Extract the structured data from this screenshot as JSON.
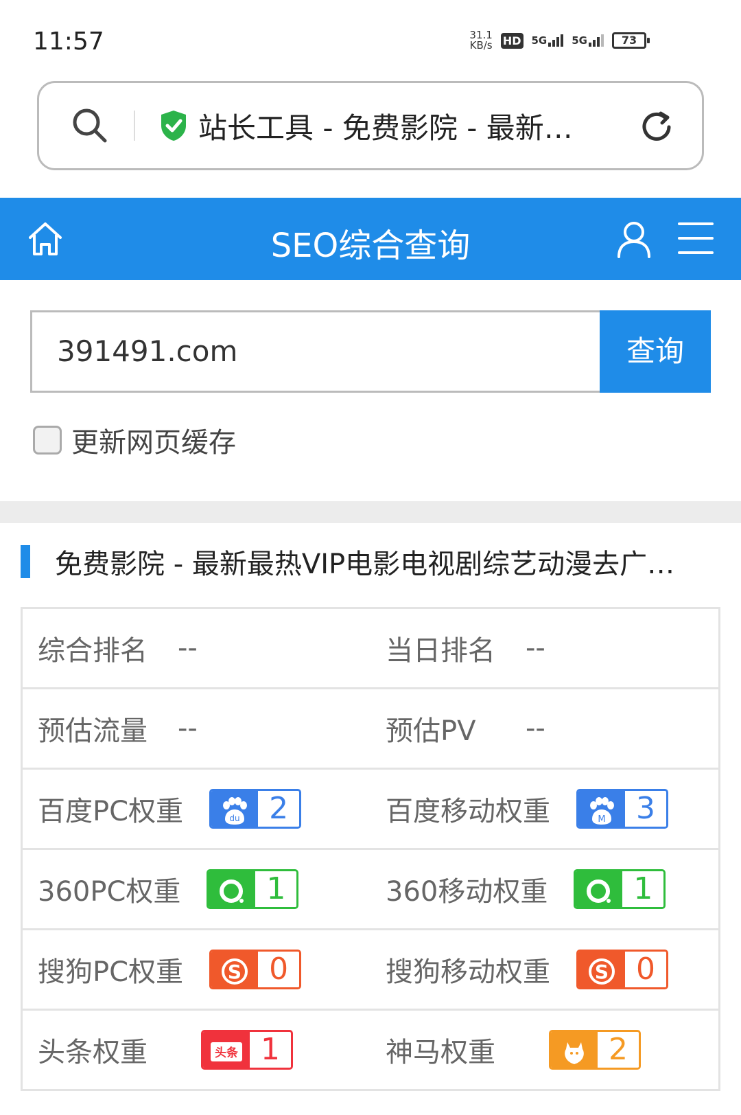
{
  "status": {
    "time": "11:57",
    "speed_value": "31.1",
    "speed_unit": "KB/s",
    "hd": "HD",
    "net1": "5G",
    "net2": "5G",
    "battery": "73"
  },
  "browser": {
    "url_title": "站长工具 - 免费影院 - 最新…"
  },
  "header": {
    "title": "SEO综合查询"
  },
  "search": {
    "value": "391491.com",
    "button": "查询",
    "cache_label": "更新网页缓存"
  },
  "site": {
    "title": "免费影院 - 最新最热VIP电影电视剧综艺动漫去广…"
  },
  "rows": [
    {
      "l_label": "综合排名",
      "l_value": "--",
      "r_label": "当日排名",
      "r_value": "--"
    },
    {
      "l_label": "预估流量",
      "l_value": "--",
      "r_label": "预估PV",
      "r_value": "--"
    },
    {
      "l_label": "百度PC权重",
      "l_value": "2",
      "l_icon": "baidu-icon",
      "r_label": "百度移动权重",
      "r_value": "3",
      "r_icon": "baidu-mobile-icon"
    },
    {
      "l_label": "360PC权重",
      "l_value": "1",
      "l_icon": "360-icon",
      "r_label": "360移动权重",
      "r_value": "1",
      "r_icon": "360-icon"
    },
    {
      "l_label": "搜狗PC权重",
      "l_value": "0",
      "l_icon": "sogou-icon",
      "r_label": "搜狗移动权重",
      "r_value": "0",
      "r_icon": "sogou-icon"
    },
    {
      "l_label": "头条权重",
      "l_value": "1",
      "l_icon": "toutiao-icon",
      "r_label": "神马权重",
      "r_value": "2",
      "r_icon": "shenma-icon"
    }
  ],
  "badge_icon_text": {
    "baidu": "du",
    "baidu_mobile": "M",
    "toutiao": "头条"
  },
  "colors": {
    "primary": "#1f8ce8",
    "baidu": "#3a7fe8",
    "so360": "#2fbd3c",
    "sogou": "#f0592b",
    "toutiao": "#f0323c",
    "shenma": "#f59a23"
  }
}
